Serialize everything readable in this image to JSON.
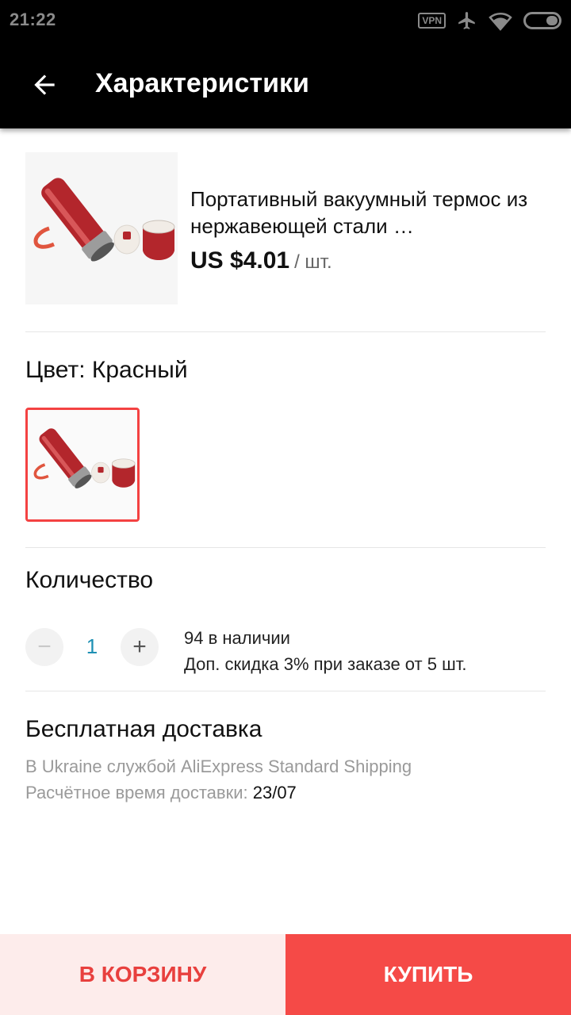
{
  "status_bar": {
    "time": "21:22",
    "vpn_label": "VPN",
    "icons": [
      "vpn-icon",
      "airplane-icon",
      "wifi-icon",
      "battery-icon"
    ]
  },
  "app_bar": {
    "back_icon": "arrow-left-icon",
    "title": "Характеристики"
  },
  "product": {
    "title": "Портативный вакуумный термос из нержавеющей стали …",
    "price": "US $4.01",
    "unit": "/ шт.",
    "image": "red-thermos-image"
  },
  "color": {
    "label": "Цвет: Красный",
    "selected_swatch": "red-thermos-image",
    "accent": "#f44242"
  },
  "quantity": {
    "label": "Количество",
    "minus": "−",
    "value": "1",
    "plus": "+",
    "stock": "94 в наличии",
    "discount": "Доп. скидка 3% при заказе от 5 шт."
  },
  "shipping": {
    "title": "Бесплатная доставка",
    "method": "В Ukraine службой AliExpress Standard Shipping",
    "estimate_label": "Расчётное время доставки:",
    "estimate_date": "23/07"
  },
  "actions": {
    "cart_label": "В КОРЗИНУ",
    "buy_label": "КУПИТЬ",
    "cart_bg": "#fdeceb",
    "buy_bg": "#f54a47"
  }
}
